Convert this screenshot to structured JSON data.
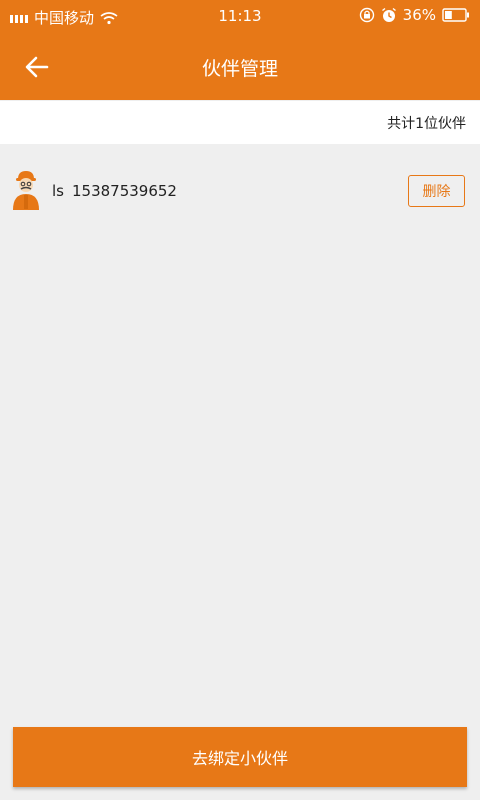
{
  "status_bar": {
    "carrier": "中国移动",
    "time": "11:13",
    "battery": "36%",
    "battery_level": 0.36
  },
  "header": {
    "title": "伙伴管理"
  },
  "summary": {
    "text": "共计1位伙伴"
  },
  "partners": [
    {
      "name": "ls",
      "phone": "15387539652",
      "delete_label": "删除"
    }
  ],
  "footer": {
    "bind_label": "去绑定小伙伴"
  },
  "colors": {
    "accent": "#e77817",
    "background": "#efefef"
  }
}
